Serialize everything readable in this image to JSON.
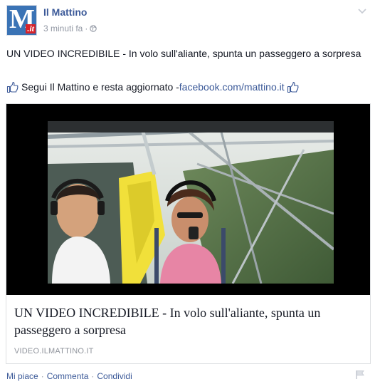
{
  "post": {
    "page": {
      "name": "Il Mattino",
      "avatar_text_main": "M",
      "avatar_text_suffix": ".it"
    },
    "timestamp": "3 minuti fa",
    "privacy_icon": "globe-icon",
    "menu_icon": "chevron-down-icon",
    "text": "UN VIDEO INCREDIBILE - In volo sull'aliante, spunta un passeggero a sorpresa",
    "follow": {
      "prefix": "Segui Il Mattino e resta aggiornato - ",
      "link": "facebook.com/mattino.it",
      "icon": "like-icon"
    },
    "link_card": {
      "title": "UN VIDEO INCREDIBILE - In volo sull'aliante, spunta un passeggero a sorpresa",
      "domain": "VIDEO.ILMATTINO.IT"
    },
    "actions": {
      "like": "Mi piace",
      "comment": "Commenta",
      "share": "Condividi",
      "separator": "·"
    },
    "flag_icon": "flag-icon",
    "colors": {
      "link_blue": "#3b5998",
      "text": "#141823",
      "meta_gray": "#9197a3",
      "brand_red": "#d8232a"
    }
  }
}
